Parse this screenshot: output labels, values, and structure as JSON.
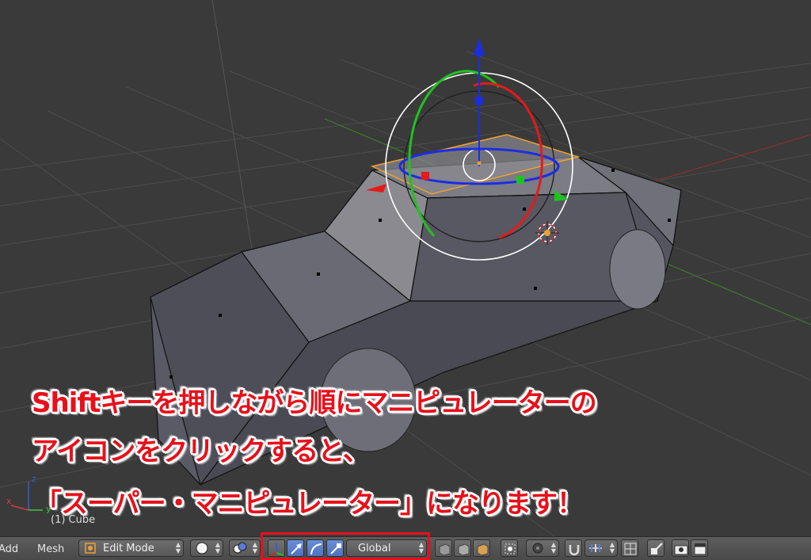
{
  "caption": {
    "line1": "Shiftキーを押しながら順にマニピュレーターの",
    "line2": "アイコンをクリックすると、",
    "line3": "「スーパー・マニピュレーター」になります！"
  },
  "viewport": {
    "object_label": "(1) Cube",
    "axis_x": "x",
    "axis_y": "y",
    "axis_z": "z"
  },
  "header": {
    "menu_add": "Add",
    "menu_mesh": "Mesh",
    "mode": "Edit Mode",
    "orientation": "Global"
  },
  "colors": {
    "highlight": "#e8101a",
    "x_axis": "#e31b1b",
    "y_axis": "#1fc21f",
    "z_axis": "#1b2de3",
    "selection": "#f0a030"
  },
  "icons": [
    "viewport-shading-icon",
    "pivot-icon",
    "manipulator-toggle-icon",
    "translate-icon",
    "rotate-icon",
    "scale-icon",
    "vertex-select-icon",
    "edge-select-icon",
    "face-select-icon",
    "occlude-icon",
    "proportional-icon",
    "snap-icon",
    "snap-target-icon",
    "render-icon",
    "camera-icon"
  ]
}
